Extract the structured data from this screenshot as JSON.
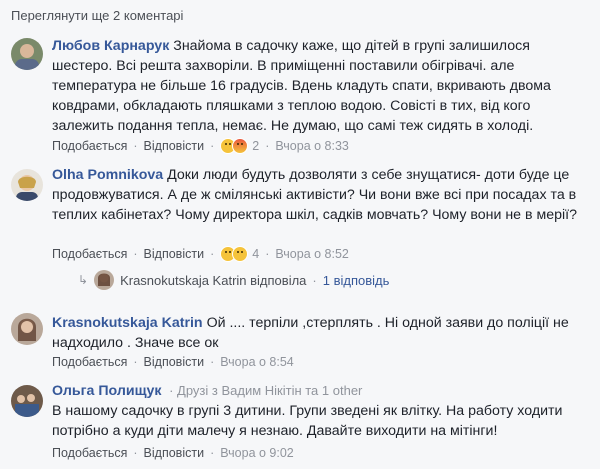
{
  "more_comments": "Переглянути ще 2 коментарі",
  "comments": [
    {
      "author": "Любов Карнарук",
      "text": "Знайома в садочку каже, що дітей в групі залишилося шестеро. Всі решта захворіли. В приміщенні поставили обігрівачі. але температура не більше 16 градусів. Вдень кладуть спати, вкривають двома ковдрами, обкладають пляшками з теплою водою. Совісті в тих, від кого залежить подання тепла, немає. Не думаю, що самі теж сидять в холоді.",
      "like": "Подобається",
      "reply": "Відповісти",
      "reactions": "2",
      "time": "Вчора о 8:33"
    },
    {
      "author": "Olha Pomnikova",
      "text": "Доки люди будуть дозволяти з себе знущатися- доти буде це продовжуватися. А де ж смілянські активісти? Чи вони вже всі при посадах та в теплих кабінетах? Чому директора шкіл, садків мовчать? Чому вони не в мерії?",
      "like": "Подобається",
      "reply": "Відповісти",
      "reactions": "4",
      "time": "Вчора о 8:52"
    },
    {
      "author": "Krasnokutskaja Katrin",
      "text": "Ой .... терпіли ,стерплять . Ні одной заяви до поліції не надходило . Значе все ок",
      "like": "Подобається",
      "reply": "Відповісти",
      "time": "Вчора о 8:54"
    },
    {
      "author": "Ольга Полищук",
      "subhead": "Друзі з Вадим Нікітін та 1 other",
      "text": "В нашому садочку в групі 3 дитини. Групи зведені як влітку. На работу ходити потрібно а куди діти малечу я незнаю. Давайте виходити на мітінги!",
      "like": "Подобається",
      "reply": "Відповісти",
      "time": "Вчора о 9:02"
    }
  ],
  "reply_summary": {
    "name": "Krasnokutskaja Katrin",
    "action": "відповіла",
    "count": "1 відповідь"
  },
  "colors": {
    "link": "#365899",
    "meta": "#90949c",
    "background": "#f6f7f9"
  }
}
